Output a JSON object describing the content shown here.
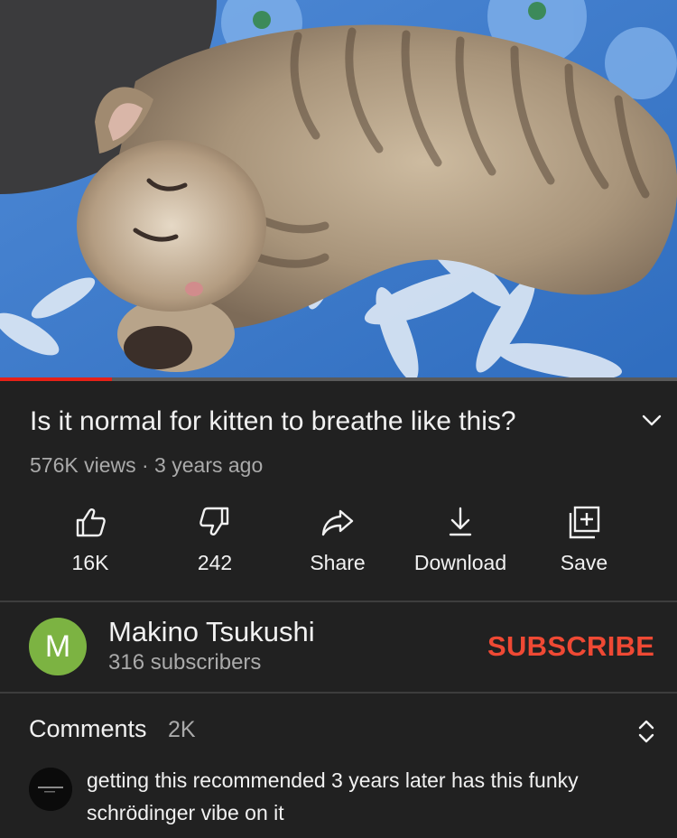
{
  "player": {
    "progress_fraction": 0.165,
    "progress_color": "#e62117"
  },
  "video": {
    "title": "Is it normal for kitten to breathe like this?",
    "meta": "576K views · 3 years ago",
    "expand_icon": "chevron-down-icon"
  },
  "actions": [
    {
      "label": "16K",
      "icon": "thumbs-up-icon"
    },
    {
      "label": "242",
      "icon": "thumbs-down-icon"
    },
    {
      "label": "Share",
      "icon": "share-icon"
    },
    {
      "label": "Download",
      "icon": "download-icon"
    },
    {
      "label": "Save",
      "icon": "add-to-playlist-icon"
    }
  ],
  "channel": {
    "avatar_letter": "M",
    "avatar_color": "#7cb342",
    "name": "Makino Tsukushi",
    "subscribers": "316 subscribers",
    "subscribe_label": "SUBSCRIBE",
    "subscribe_color": "#ef4934"
  },
  "comments": {
    "title": "Comments",
    "count": "2K",
    "sort_icon": "expand-collapse-icon",
    "first": {
      "text": "getting this recommended 3 years later has this funky schrödinger vibe on it"
    }
  }
}
